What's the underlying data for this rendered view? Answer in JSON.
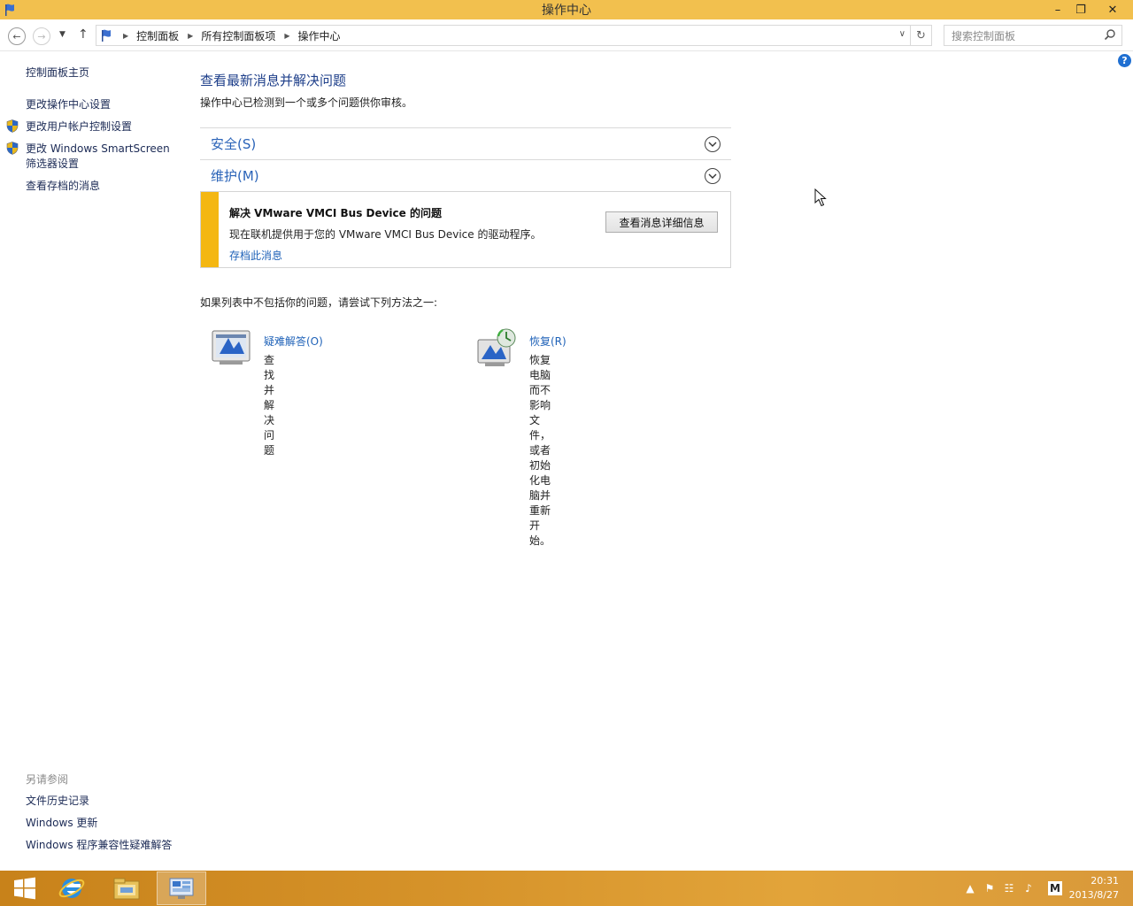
{
  "window": {
    "title": "操作中心"
  },
  "address": {
    "crumbs": [
      "控制面板",
      "所有控制面板项",
      "操作中心"
    ],
    "search_placeholder": "搜索控制面板"
  },
  "leftpane": {
    "home": "控制面板主页",
    "links": [
      "更改操作中心设置",
      "更改用户帐户控制设置",
      "更改 Windows SmartScreen",
      "筛选器设置",
      "查看存档的消息"
    ],
    "see_also_heading": "另请参阅",
    "see_also": [
      "文件历史记录",
      "Windows 更新",
      "Windows 程序兼容性疑难解答"
    ]
  },
  "main": {
    "title": "查看最新消息并解决问题",
    "subtitle": "操作中心已检测到一个或多个问题供你审核。",
    "sections": [
      {
        "label": "安全(S)"
      },
      {
        "label": "维护(M)"
      }
    ],
    "alert": {
      "title": "解决 VMware VMCI Bus Device 的问题",
      "desc": "现在联机提供用于您的 VMware VMCI Bus Device 的驱动程序。",
      "archive_link": "存档此消息",
      "details_button": "查看消息详细信息",
      "color": "#f4b712"
    },
    "hint": "如果列表中不包括你的问题，请尝试下列方法之一:",
    "tools": [
      {
        "name": "疑难解答(O)",
        "desc_lines": [
          "查找并解决问题"
        ],
        "icon": "troubleshoot-icon"
      },
      {
        "name": "恢复(R)",
        "desc_lines": [
          "恢复电脑而不影响文件，或者初始",
          "化电脑并重新开始。"
        ],
        "icon": "recovery-icon"
      }
    ]
  },
  "taskbar": {
    "apps": [
      "windows-start-icon",
      "internet-explorer-icon",
      "file-explorer-icon",
      "control-panel-icon"
    ],
    "tray_text": "M",
    "clock_time": "20:31",
    "clock_date": "2013/8/27"
  }
}
